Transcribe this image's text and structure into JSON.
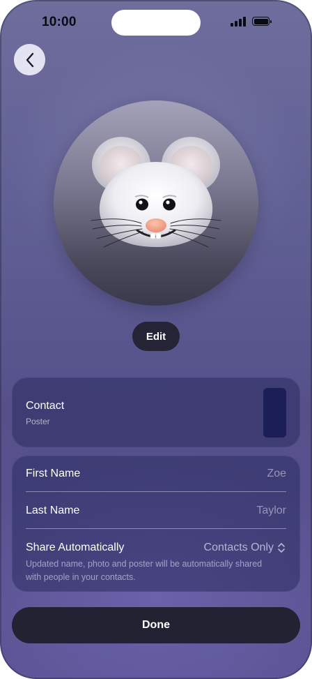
{
  "status_bar": {
    "time": "10:00"
  },
  "back": {
    "icon": "chevron-left-icon"
  },
  "avatar": {
    "memoji": "mouse-memoji"
  },
  "edit": {
    "label": "Edit"
  },
  "poster": {
    "title": "Contact",
    "subtitle": "Poster"
  },
  "fields": {
    "first_name": {
      "label": "First Name",
      "value": "Zoe"
    },
    "last_name": {
      "label": "Last Name",
      "value": "Taylor"
    }
  },
  "share": {
    "label": "Share Automatically",
    "value": "Contacts Only",
    "icon": "chevron-up-down-icon",
    "description": "Updated name, photo and poster will be automatically shared with people in your contacts."
  },
  "done": {
    "label": "Done"
  },
  "colors": {
    "background": "#5f5e93",
    "card": "#2c2c60",
    "button_dark": "#222232",
    "poster_thumb": "#1c1e58"
  }
}
